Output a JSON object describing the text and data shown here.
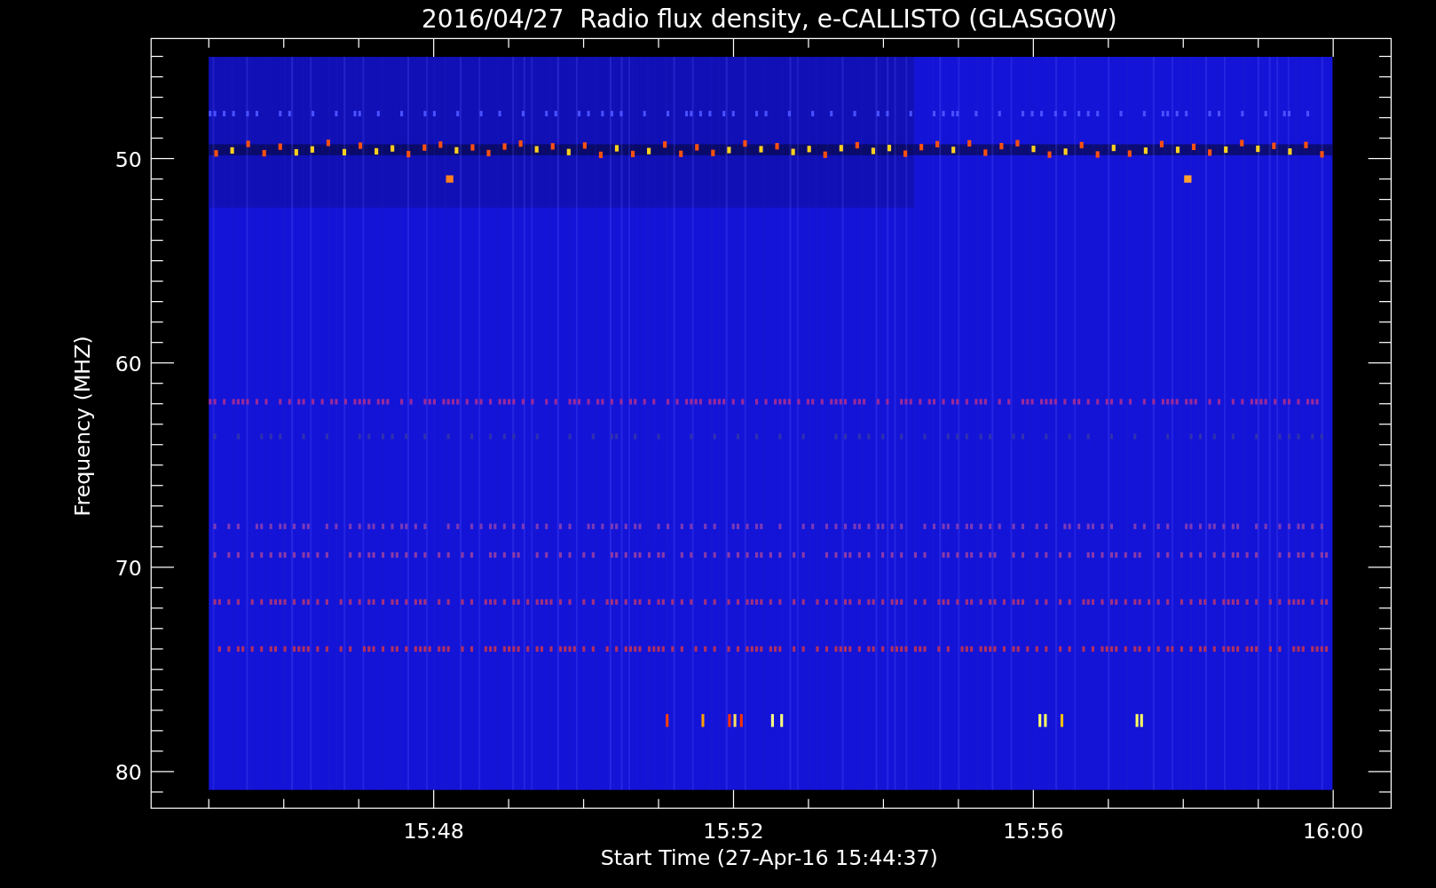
{
  "title": "2016/04/27  Radio flux density, e-CALLISTO (GLASGOW)",
  "plot": {
    "xlabel": "Start Time (27-Apr-16 15:44:37)",
    "ylabel": "Frequency (MHZ)",
    "xticks": [
      "15:48",
      "15:52",
      "15:56",
      "16:00"
    ],
    "yticks": [
      "50",
      "60",
      "70",
      "80"
    ]
  }
}
